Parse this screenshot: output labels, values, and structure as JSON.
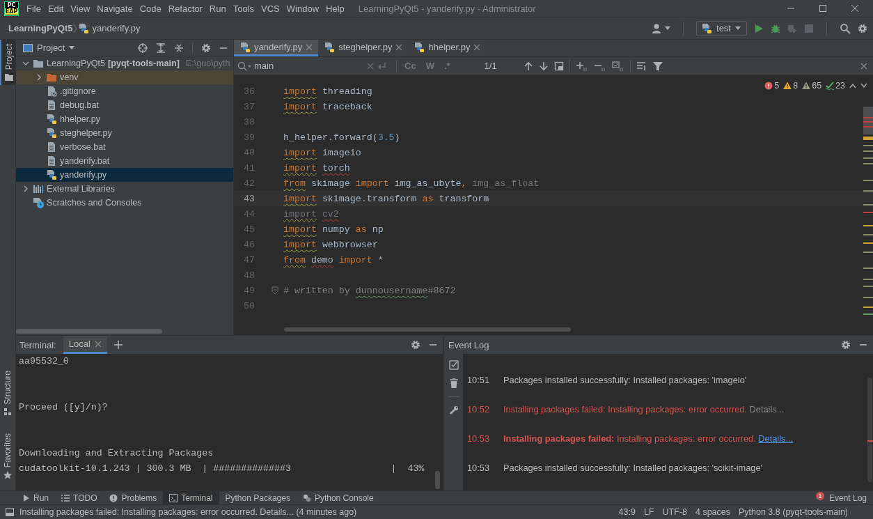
{
  "window": {
    "logo": [
      "PC",
      "EAP"
    ],
    "menu": [
      "File",
      "Edit",
      "View",
      "Navigate",
      "Code",
      "Refactor",
      "Run",
      "Tools",
      "VCS",
      "Window",
      "Help"
    ],
    "title": "LearningPyQt5 - yanderify.py - Administrator"
  },
  "navbar": {
    "breadcrumb": [
      {
        "label": "LearningPyQt5",
        "kind": "project"
      },
      {
        "label": "yanderify.py",
        "kind": "python"
      }
    ],
    "run_config": "test",
    "actions": [
      {
        "kind": "run",
        "disabled": false
      },
      {
        "kind": "debug",
        "disabled": false
      },
      {
        "kind": "coverage",
        "disabled": true
      },
      {
        "kind": "stop",
        "disabled": true
      }
    ]
  },
  "stripe": {
    "top": [
      {
        "label": "Project",
        "selected": true
      }
    ],
    "bottom": [
      {
        "label": "Structure",
        "selected": false
      },
      {
        "label": "Favorites",
        "selected": false
      }
    ]
  },
  "project": {
    "title": "Project",
    "tree": [
      {
        "label": "LearningPyQt5",
        "module": "[pyqt-tools-main]",
        "path": "E:\\guo\\pyth",
        "kind": "folder",
        "expanded": true,
        "selected": false,
        "children": [
          {
            "label": "venv",
            "kind": "excluded",
            "expanded": false,
            "selected": false
          },
          {
            "label": ".gitignore",
            "kind": "ignore",
            "selected": false
          },
          {
            "label": "debug.bat",
            "kind": "text",
            "selected": false
          },
          {
            "label": "hhelper.py",
            "kind": "python",
            "selected": false
          },
          {
            "label": "steghelper.py",
            "kind": "python",
            "selected": false
          },
          {
            "label": "verbose.bat",
            "kind": "text",
            "selected": false
          },
          {
            "label": "yanderify.bat",
            "kind": "text",
            "selected": false
          },
          {
            "label": "yanderify.py",
            "kind": "python",
            "selected": true
          }
        ]
      },
      {
        "label": "External Libraries",
        "kind": "libraries",
        "expanded": false,
        "selected": false
      },
      {
        "label": "Scratches and Consoles",
        "kind": "scratches",
        "selected": false
      }
    ]
  },
  "editor": {
    "tabs": [
      {
        "label": "yanderify.py",
        "selected": true
      },
      {
        "label": "steghelper.py",
        "selected": false
      },
      {
        "label": "hhelper.py",
        "selected": false
      }
    ],
    "search": {
      "value": "main",
      "options": [
        "Cc",
        "W",
        ".*"
      ],
      "matches": "1/1"
    },
    "inspections": [
      {
        "kind": "error",
        "count": "5"
      },
      {
        "kind": "warning",
        "count": "8"
      },
      {
        "kind": "weak",
        "count": "65"
      },
      {
        "kind": "typo",
        "count": "23"
      }
    ],
    "lines": [
      {
        "number": "36",
        "current": false,
        "fold": false,
        "tokens": [
          {
            "text": "import",
            "kind": "keyword_weak"
          },
          {
            "text": " threading",
            "kind": "name"
          }
        ]
      },
      {
        "number": "37",
        "current": false,
        "fold": false,
        "tokens": [
          {
            "text": "import",
            "kind": "keyword_weak"
          },
          {
            "text": " traceback",
            "kind": "name"
          }
        ]
      },
      {
        "number": "38",
        "current": false,
        "fold": false
      },
      {
        "number": "39",
        "current": false,
        "fold": false,
        "tokens": [
          {
            "text": "h_helper.forward(",
            "kind": "name"
          },
          {
            "text": "3.5",
            "kind": "number"
          },
          {
            "text": ")",
            "kind": "name"
          }
        ]
      },
      {
        "number": "40",
        "current": false,
        "fold": false,
        "tokens": [
          {
            "text": "import",
            "kind": "keyword_weak"
          },
          {
            "text": " imageio",
            "kind": "name"
          }
        ]
      },
      {
        "number": "41",
        "current": false,
        "fold": false,
        "tokens": [
          {
            "text": "import",
            "kind": "keyword_weak"
          },
          {
            "text": " torch",
            "kind": "name_error"
          }
        ]
      },
      {
        "number": "42",
        "current": false,
        "fold": false,
        "tokens": [
          {
            "text": "from",
            "kind": "keyword_weak"
          },
          {
            "text": " skimage ",
            "kind": "name"
          },
          {
            "text": "import",
            "kind": "keyword"
          },
          {
            "text": " img_as_ubyte",
            "kind": "name"
          },
          {
            "text": ", ",
            "kind": "keyword"
          },
          {
            "text": "img_as_float",
            "kind": "unused"
          }
        ]
      },
      {
        "number": "43",
        "current": true,
        "fold": false,
        "tokens": [
          {
            "text": "import",
            "kind": "keyword_weak"
          },
          {
            "text": " skimage.transform ",
            "kind": "name"
          },
          {
            "text": "as",
            "kind": "keyword"
          },
          {
            "text": " transform",
            "kind": "name"
          }
        ]
      },
      {
        "number": "44",
        "current": false,
        "fold": false,
        "tokens": [
          {
            "text": "import",
            "kind": "unused_weak"
          },
          {
            "text": " cv2",
            "kind": "unused_error"
          }
        ]
      },
      {
        "number": "45",
        "current": false,
        "fold": false,
        "tokens": [
          {
            "text": "import",
            "kind": "keyword_weak"
          },
          {
            "text": " numpy ",
            "kind": "name"
          },
          {
            "text": "as",
            "kind": "keyword"
          },
          {
            "text": " np",
            "kind": "name"
          }
        ]
      },
      {
        "number": "46",
        "current": false,
        "fold": false,
        "tokens": [
          {
            "text": "import",
            "kind": "keyword_weak"
          },
          {
            "text": " webbrowser",
            "kind": "name"
          }
        ]
      },
      {
        "number": "47",
        "current": false,
        "fold": false,
        "tokens": [
          {
            "text": "from",
            "kind": "keyword_weak"
          },
          {
            "text": " demo",
            "kind": "name_error"
          },
          {
            "text": " import",
            "kind": "keyword"
          },
          {
            "text": " *",
            "kind": "name"
          }
        ]
      },
      {
        "number": "48",
        "current": false,
        "fold": false
      },
      {
        "number": "49",
        "current": false,
        "fold": true,
        "tokens": [
          {
            "text": "# written by ",
            "kind": "comment"
          },
          {
            "text": "dunnousername",
            "kind": "comment_typo"
          },
          {
            "text": "#8672",
            "kind": "comment"
          }
        ]
      },
      {
        "number": "50",
        "current": false,
        "fold": false
      }
    ]
  },
  "terminal": {
    "title": "Terminal:",
    "tabs": [
      {
        "label": "Local",
        "selected": true
      }
    ],
    "blocks": [
      [
        "aa95532_0"
      ],
      [
        "Proceed ([y]/n)?"
      ],
      [
        "Downloading and Extracting Packages",
        "cudatoolkit-10.1.243 | 300.3 MB  | #############3                  |  43%"
      ]
    ]
  },
  "event_log": {
    "title": "Event Log",
    "entries": [
      {
        "time": "10:51",
        "kind": "info",
        "unread": false,
        "title": "Packages installed successfully:",
        "message": "Installed packages: 'imageio'"
      },
      {
        "time": "10:52",
        "kind": "error",
        "unread": false,
        "title": "Installing packages failed:",
        "message": "Installing packages: error occurred.",
        "details": "Details..."
      },
      {
        "time": "10:53",
        "kind": "error",
        "unread": true,
        "title": "Installing packages failed:",
        "message": "Installing packages: error occurred.",
        "details": "Details..."
      },
      {
        "time": "10:53",
        "kind": "info",
        "unread": false,
        "title": "Packages installed successfully:",
        "message": "Installed packages: 'scikit-image'"
      }
    ]
  },
  "tool_windows": {
    "left": [
      {
        "label": "Run",
        "kind": "run",
        "selected": false
      },
      {
        "label": "TODO",
        "kind": "todo",
        "selected": false
      },
      {
        "label": "Problems",
        "kind": "problems",
        "selected": false
      },
      {
        "label": "Terminal",
        "kind": "terminal",
        "selected": true
      },
      {
        "label": "Python Packages",
        "kind": "packages",
        "selected": false
      },
      {
        "label": "Python Console",
        "kind": "console",
        "selected": false
      }
    ],
    "right": [
      {
        "label": "Event Log",
        "badge": "1",
        "selected": false
      }
    ]
  },
  "status_bar": {
    "message": "Installing packages failed: Installing packages: error occurred. Details... (4 minutes ago)",
    "items": [
      "43:9",
      "LF",
      "UTF-8",
      "4 spaces",
      "Python 3.8 (pyqt-tools-main)"
    ]
  }
}
